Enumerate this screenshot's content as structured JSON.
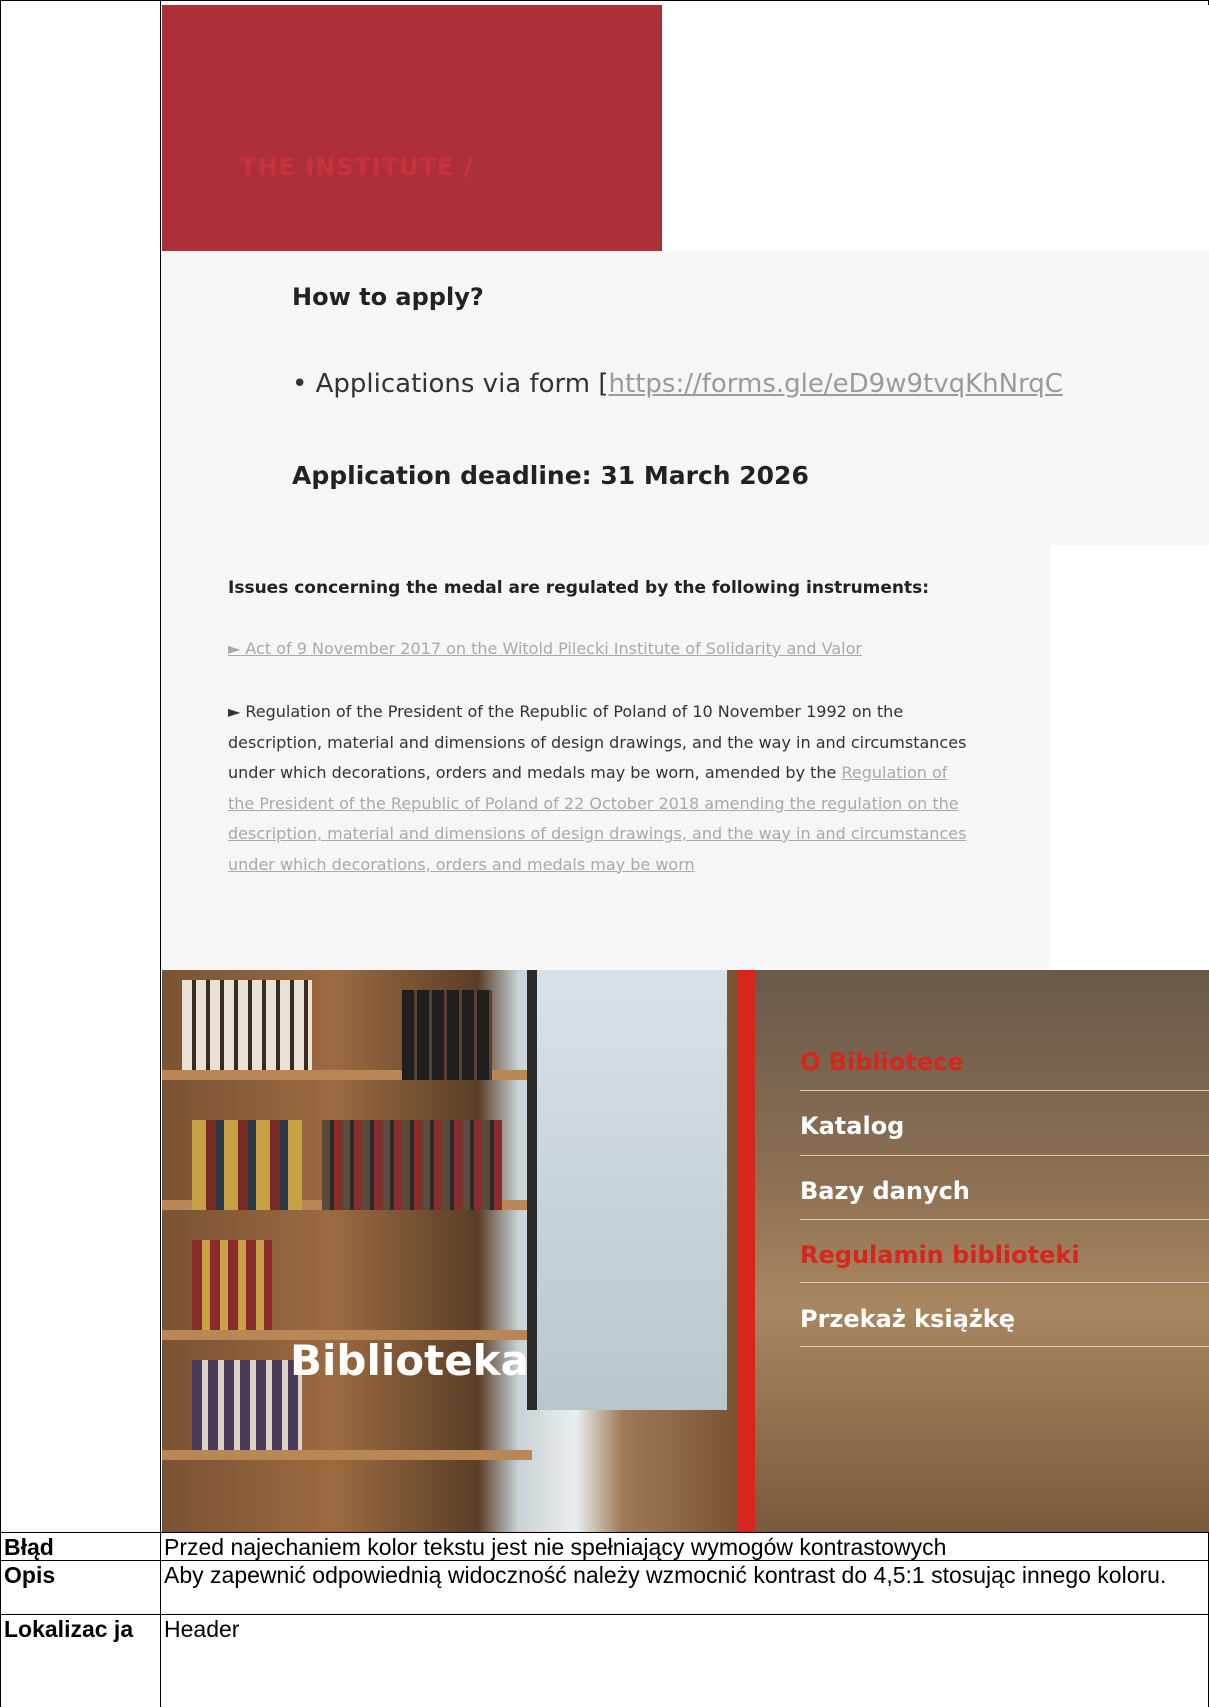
{
  "screenshot": {
    "institute_text": "THE INSTITUTE /",
    "apply_title": "How to apply?",
    "apply_bullet_text": "• Applications via form [",
    "apply_link": "https://forms.gle/eD9w9tvqKhNrqC",
    "deadline": "Application deadline: 31 March 2026",
    "issues_title": "Issues concerning the medal are regulated by the following instruments:",
    "act_link": "► Act of 9 November 2017 on the Witold Pilecki Institute of Solidarity and Valor",
    "regulation_text": "► Regulation of the President of the Republic of Poland of 10 November 1992 on the description, material and dimensions of design drawings, and the way in and circumstances under which decorations, orders and medals may be worn, amended by the ",
    "regulation_link": "Regulation of the President of the Republic of Poland of 22 October 2018 amending the regulation on the description, material and dimensions of design drawings, and the way in and circumstances under which decorations, orders and medals may be worn",
    "library_title": "Biblioteka",
    "menu": [
      {
        "label": "O Bibliotece"
      },
      {
        "label": "Katalog"
      },
      {
        "label": "Bazy danych"
      },
      {
        "label": "Regulamin biblioteki"
      },
      {
        "label": "Przekaż książkę"
      }
    ]
  },
  "rows": {
    "error": {
      "label": "Błąd",
      "value": "Przed najechaniem kolor tekstu jest nie spełniający wymogów kontrastowych"
    },
    "description": {
      "label": "Opis",
      "value": "Aby zapewnić odpowiednią widoczność należy wzmocnić kontrast do 4,5:1 stosując innego koloru."
    },
    "location": {
      "label": "Lokalizac ja",
      "value": "Header"
    }
  },
  "colors": {
    "brand_red": "#ad2f38",
    "accent_red": "#d7261c",
    "link_gray": "#a9a9a9"
  }
}
